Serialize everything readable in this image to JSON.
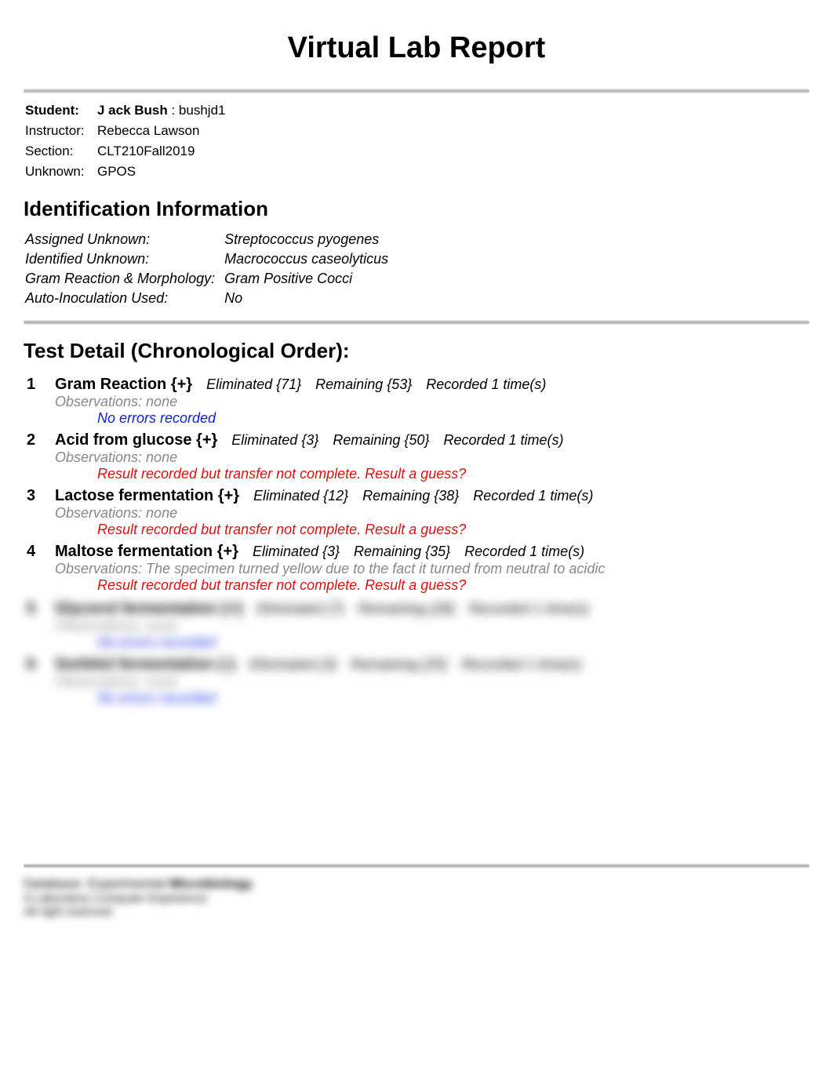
{
  "title": "Virtual Lab Report",
  "info": {
    "student_label": "Student:",
    "student_name": "J ack Bush",
    "student_id": " : bushjd1",
    "instructor_label": "Instructor:",
    "instructor_value": "Rebecca Lawson",
    "section_label": "Section:",
    "section_value": "CLT210Fall2019",
    "unknown_label": "Unknown:",
    "unknown_value": "GPOS"
  },
  "id_heading": "Identification Information",
  "id_info": [
    {
      "label": "Assigned Unknown:",
      "value": "Streptococcus pyogenes"
    },
    {
      "label": "Identified Unknown:",
      "value": "Macrococcus caseolyticus"
    },
    {
      "label": "Gram Reaction & Morphology:",
      "value": "Gram Positive Cocci"
    },
    {
      "label": "Auto-Inoculation Used:",
      "value": "No"
    }
  ],
  "tests_heading": "Test Detail (Chronological Order):",
  "tests": [
    {
      "num": "1",
      "name": "Gram Reaction {+}",
      "eliminated": "Eliminated {71}",
      "remaining": "Remaining {53}",
      "recorded": "Recorded 1 time(s)",
      "obs": "Observations: none",
      "msg": "No errors recorded",
      "msg_class": "msg-blue"
    },
    {
      "num": "2",
      "name": "Acid from glucose {+}",
      "eliminated": "Eliminated {3}",
      "remaining": "Remaining {50}",
      "recorded": "Recorded 1 time(s)",
      "obs": "Observations: none",
      "msg": "Result recorded but transfer not complete. Result a guess?",
      "msg_class": "msg-red"
    },
    {
      "num": "3",
      "name": "Lactose fermentation {+}",
      "eliminated": "Eliminated {12}",
      "remaining": "Remaining {38}",
      "recorded": "Recorded 1 time(s)",
      "obs": "Observations: none",
      "msg": "Result recorded but transfer not complete. Result a guess?",
      "msg_class": "msg-red"
    },
    {
      "num": "4",
      "name": "Maltose fermentation {+}",
      "eliminated": "Eliminated {3}",
      "remaining": "Remaining {35}",
      "recorded": "Recorded 1 time(s)",
      "obs": "Observations: The specimen turned yellow due to the fact it turned from neutral to acidic",
      "msg": "Result recorded but transfer not complete. Result a guess?",
      "msg_class": "msg-red"
    }
  ],
  "blurred_tests": [
    {
      "num": "5",
      "name": "Glycerol fermentation {+}",
      "eliminated": "Eliminated {7}",
      "remaining": "Remaining {28}",
      "recorded": "Recorded 1 time(s)",
      "obs": "Observations: none",
      "msg": "No errors recorded",
      "msg_class": "msg-blue"
    },
    {
      "num": "6",
      "name": "Sorbitol fermentation {-}",
      "eliminated": "Eliminated {3}",
      "remaining": "Remaining {25}",
      "recorded": "Recorded 1 time(s)",
      "obs": "Observations: none",
      "msg": "No errors recorded",
      "msg_class": "msg-blue"
    }
  ],
  "footer": {
    "line1_a": "Database: Experimental ",
    "line1_b": "Microbiology",
    "line2": "A Laboratory Computer Experience",
    "line3": "All right reserved"
  }
}
